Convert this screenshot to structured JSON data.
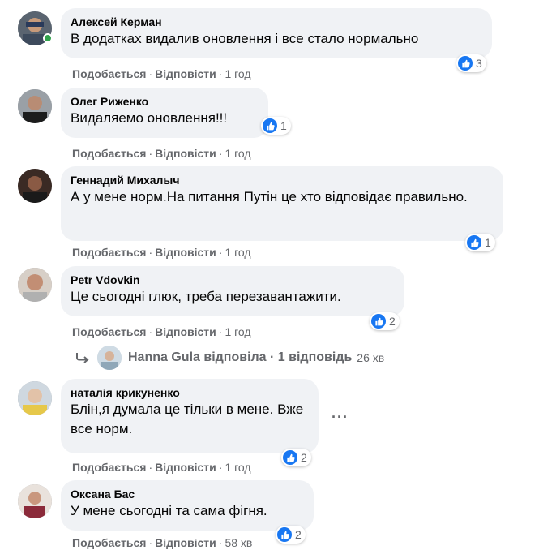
{
  "actions": {
    "like": "Подобається",
    "reply": "Відповісти",
    "separator": "·"
  },
  "comments": [
    {
      "author": "Алексей Керман",
      "text": "В додатках видалив оновлення і все стало нормально",
      "reactions": "3",
      "time": "1 год"
    },
    {
      "author": "Олег Риженко",
      "text": "Видаляемо оновлення!!!",
      "reactions": "1",
      "time": "1 год"
    },
    {
      "author": "Геннадий Михалыч",
      "text": "А у мене норм.На питання Путін це хто відповідає правильно.",
      "reactions": "1",
      "time": "1 год"
    },
    {
      "author": "Petr Vdovkin",
      "text": "Це сьогодні глюк, треба перезавантажити.",
      "reactions": "2",
      "time": "1 год"
    },
    {
      "author": "наталія крикуненко",
      "text": "Блін,я думала це тільки в мене. Вже все норм.",
      "reactions": "2",
      "time": "1 год"
    },
    {
      "author": "Оксана Бас",
      "text": "У мене сьогодні та сама фігня.",
      "reactions": "2",
      "time": "58 хв"
    }
  ],
  "reply_thread": {
    "label": "Hanna Gula відповіла · 1 відповідь",
    "time": "26 хв"
  },
  "more_options": "···",
  "colors": {
    "like_blue": "#1877f2",
    "bubble": "#f0f2f5",
    "meta": "#65676b",
    "online": "#31a24c"
  },
  "icons": [
    "like-icon",
    "reply-arrow-icon",
    "more-options-icon"
  ]
}
